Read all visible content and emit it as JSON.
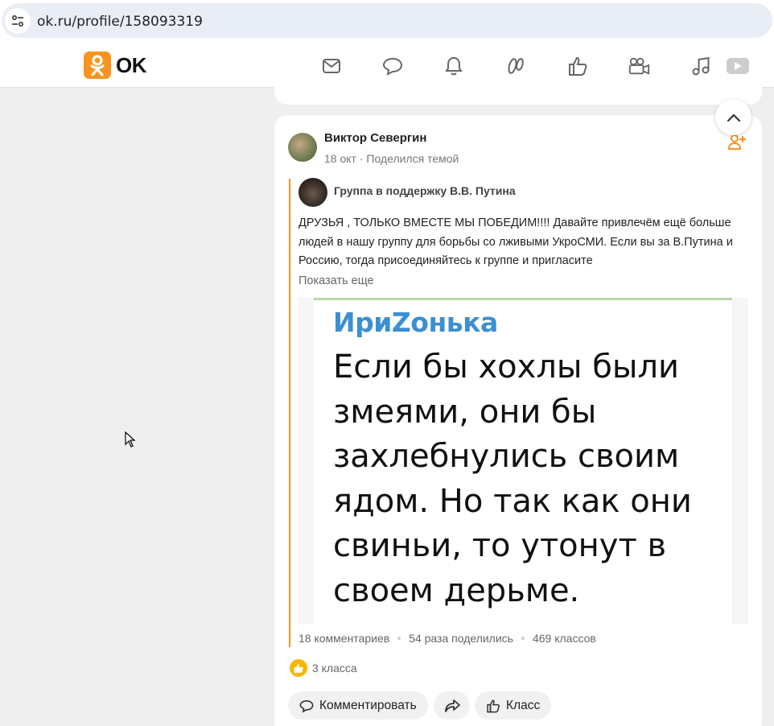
{
  "browser": {
    "url": "ok.ru/profile/158093319",
    "tune_icon": "site-settings-icon"
  },
  "header": {
    "logo_text": "OK",
    "nav_icons": [
      "mail-icon",
      "chat-icon",
      "bell-icon",
      "guests-icon",
      "like-icon",
      "video-camera-icon",
      "music-icon",
      "play-icon"
    ]
  },
  "post": {
    "author": "Виктор Севергин",
    "date": "18 окт",
    "separator": "·",
    "action": "Поделился темой",
    "group_name": "Группа в поддержку В.В. Путина",
    "text": "ДРУЗЬЯ , ТОЛЬКО ВМЕСТЕ МЫ ПОБЕДИМ!!!! Давайте привлечём ещё больше людей в нашу группу для борьбы со лживыми УкроСМИ. Если вы за В.Путина и Россию, тогда присоединяйтесь к группе и пригласите",
    "show_more": "Показать еще",
    "image": {
      "nickname": "ИриZонька",
      "text": "Если бы хохлы были змеями, они бы захлебнулись своим ядом. Но так как они свиньи, то  утонут в своем дерьме."
    },
    "stats": {
      "comments": "18 комментариев",
      "shares": "54 раза поделились",
      "klasses": "469 классов"
    },
    "own_klass": "3 класса",
    "buttons": {
      "comment": "Комментировать",
      "klass": "Класс"
    }
  },
  "colors": {
    "accent": "#f7931e",
    "background": "#efefef",
    "nickname_blue": "#3c8fd1"
  }
}
